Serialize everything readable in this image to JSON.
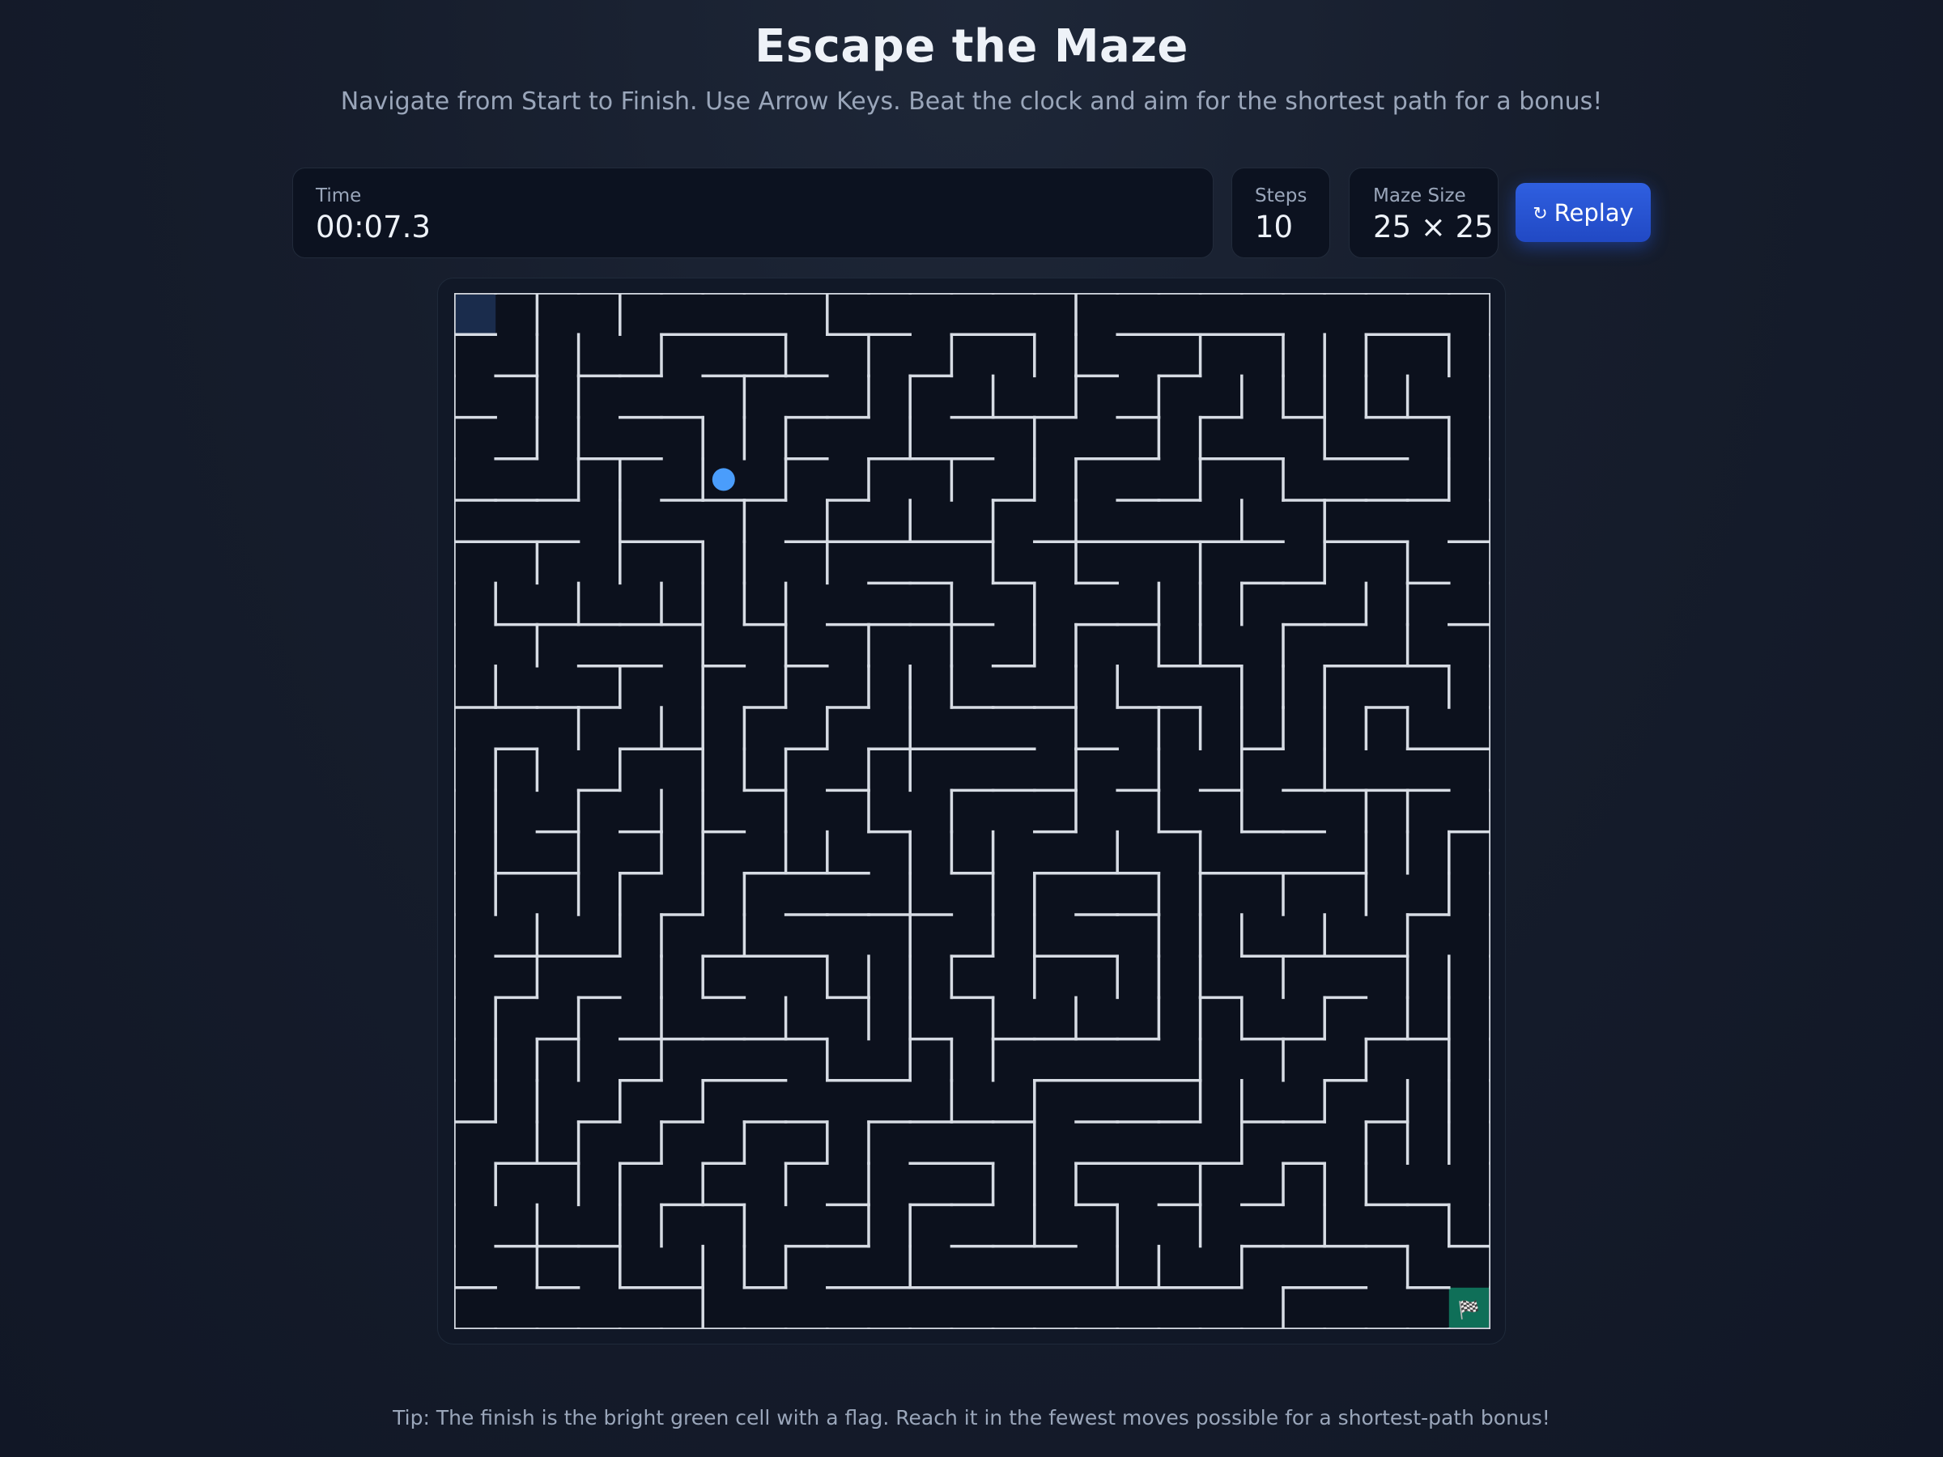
{
  "title": "Escape the Maze",
  "subtitle": "Navigate from Start to Finish. Use Arrow Keys. Beat the clock and aim for the shortest path for a bonus!",
  "stats": {
    "time": {
      "label": "Time",
      "value": "00:07.3"
    },
    "steps": {
      "label": "Steps",
      "value": "10"
    },
    "maze_size": {
      "label": "Maze Size",
      "value": "25 × 25"
    }
  },
  "replay": {
    "icon": "↻",
    "label": "Replay"
  },
  "maze": {
    "rows": 25,
    "cols": 25,
    "start": [
      0,
      0
    ],
    "finish": [
      24,
      24
    ],
    "player": [
      4,
      6
    ],
    "finish_icon": "🏁",
    "colors": {
      "wall": "#d7dce4",
      "floor": "#0c111d",
      "start": "#1a2c4c",
      "finish": "#0f6f58",
      "player": "#4a9dfc"
    }
  },
  "tip": "Tip: The finish is the bright green cell with a flag. Reach it in the fewest moves possible for a shortest-path bonus!"
}
